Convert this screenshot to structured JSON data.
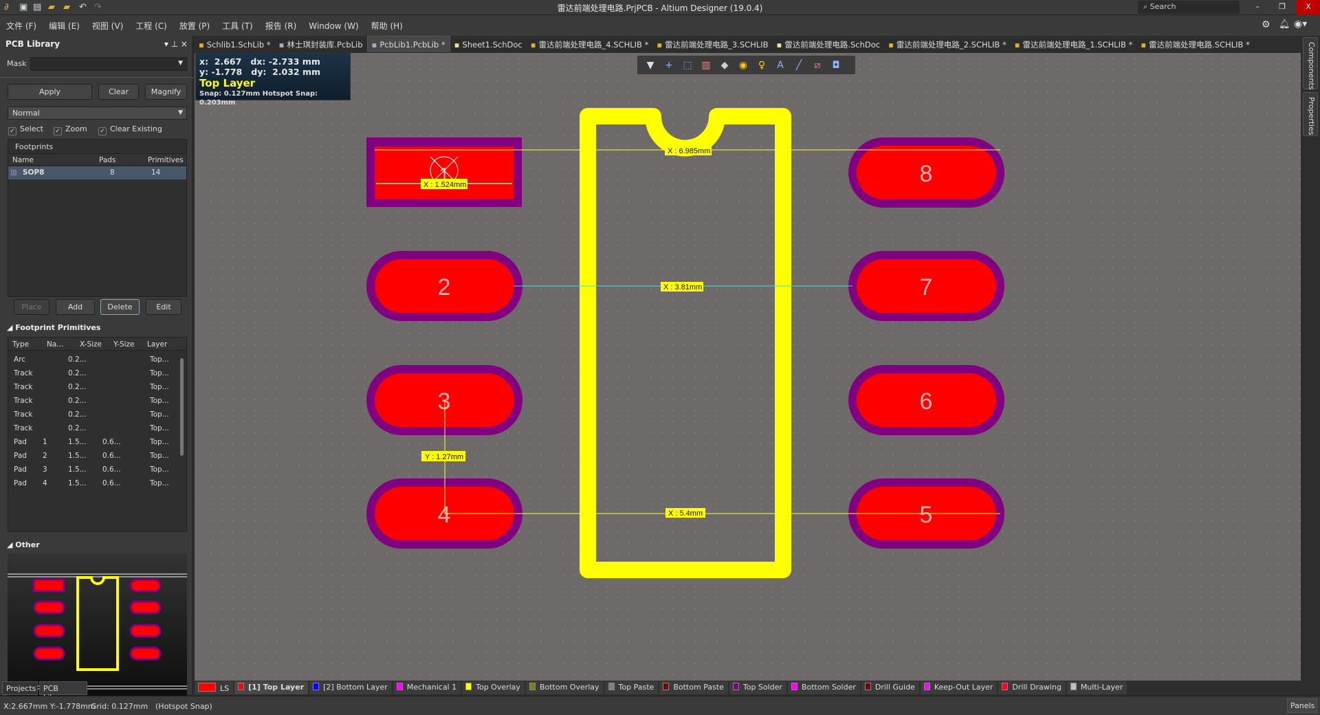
{
  "window": {
    "title": "雷达前端处理电路.PrjPCB - Altium Designer (19.0.4)",
    "search_placeholder": "Search",
    "minimize": "–",
    "restore": "❐",
    "close": "X"
  },
  "menu": [
    "文件 (F)",
    "编辑 (E)",
    "视图 (V)",
    "工程 (C)",
    "放置 (P)",
    "工具 (T)",
    "报告 (R)",
    "Window (W)",
    "帮助 (H)"
  ],
  "doc_tabs": [
    {
      "label": "Schlib1.SchLib *",
      "active": false
    },
    {
      "label": "林士琪封装库.PcbLib",
      "active": false
    },
    {
      "label": "PcbLib1.PcbLib *",
      "active": true
    },
    {
      "label": "Sheet1.SchDoc",
      "active": false
    },
    {
      "label": "雷达前端处理电路_4.SCHLIB *",
      "active": false
    },
    {
      "label": "雷达前端处理电路_3.SCHLIB",
      "active": false
    },
    {
      "label": "雷达前端处理电路.SchDoc",
      "active": false
    },
    {
      "label": "雷达前端处理电路_2.SCHLIB *",
      "active": false
    },
    {
      "label": "雷达前端处理电路_1.SCHLIB *",
      "active": false
    },
    {
      "label": "雷达前端处理电路.SCHLIB *",
      "active": false
    }
  ],
  "panel": {
    "title": "PCB Library",
    "mask_label": "Mask",
    "mask_value": "",
    "apply": "Apply",
    "clear": "Clear",
    "magnify": "Magnify",
    "mode": "Normal",
    "checks": [
      {
        "label": "Select",
        "checked": true
      },
      {
        "label": "Zoom",
        "checked": true
      },
      {
        "label": "Clear Existing",
        "checked": true
      }
    ],
    "footprints_title": "Footprints",
    "fp_columns": [
      "Name",
      "Pads",
      "Primitives"
    ],
    "footprints": [
      {
        "name": "SOP8",
        "pads": "8",
        "primitives": "14"
      }
    ],
    "place": "Place",
    "add": "Add",
    "delete": "Delete",
    "edit": "Edit",
    "primitives_title": "Footprint Primitives",
    "prim_columns": [
      "Type",
      "Na...",
      "X-Size",
      "Y-Size",
      "Layer"
    ],
    "primitives": [
      {
        "type": "Arc",
        "name": "",
        "x": "0.2...",
        "y": "",
        "layer": "Top..."
      },
      {
        "type": "Track",
        "name": "",
        "x": "0.2...",
        "y": "",
        "layer": "Top..."
      },
      {
        "type": "Track",
        "name": "",
        "x": "0.2...",
        "y": "",
        "layer": "Top..."
      },
      {
        "type": "Track",
        "name": "",
        "x": "0.2...",
        "y": "",
        "layer": "Top..."
      },
      {
        "type": "Track",
        "name": "",
        "x": "0.2...",
        "y": "",
        "layer": "Top..."
      },
      {
        "type": "Track",
        "name": "",
        "x": "0.2...",
        "y": "",
        "layer": "Top..."
      },
      {
        "type": "Pad",
        "name": "1",
        "x": "1.5...",
        "y": "0.6...",
        "layer": "Top..."
      },
      {
        "type": "Pad",
        "name": "2",
        "x": "1.5...",
        "y": "0.6...",
        "layer": "Top..."
      },
      {
        "type": "Pad",
        "name": "3",
        "x": "1.5...",
        "y": "0.6...",
        "layer": "Top..."
      },
      {
        "type": "Pad",
        "name": "4",
        "x": "1.5...",
        "y": "0.6...",
        "layer": "Top..."
      }
    ],
    "other_title": "Other",
    "bottom_tabs": [
      "Projects",
      "PCB Library"
    ]
  },
  "coord_box": {
    "x": "x:  2.667   dx: -2.733 mm",
    "y": "y: -1.778   dy:  2.032 mm",
    "layer": "Top Layer",
    "snap": "Snap: 0.127mm Hotspot Snap: 0.203mm"
  },
  "toolbar_icons": [
    "filter-icon",
    "crosshair-icon",
    "select-rect-icon",
    "align-icon",
    "component-icon",
    "pad-icon",
    "via-icon",
    "text-icon",
    "line-icon",
    "route-icon",
    "region-icon"
  ],
  "pads": [
    {
      "label": "1",
      "shape": "rect"
    },
    {
      "label": "2"
    },
    {
      "label": "3"
    },
    {
      "label": "4"
    },
    {
      "label": "5"
    },
    {
      "label": "6"
    },
    {
      "label": "7"
    },
    {
      "label": "8"
    }
  ],
  "dimensions": {
    "d1": "X : 6.985mm",
    "d2": "X : 1.524mm",
    "d3": "X : 3.81mm",
    "d4": "Y : 1.27mm",
    "d5": "X : 5.4mm"
  },
  "colors": {
    "pad": "#ff0000",
    "solder_mask": "#800080",
    "overlay": "#ffff00",
    "canvas": "#6e6a69"
  },
  "right_tabs": [
    "Components",
    "Properties"
  ],
  "layers": [
    {
      "label": "LS",
      "color": "#ff0000"
    },
    {
      "label": "[1] Top Layer",
      "color": "#ff0000",
      "active": true
    },
    {
      "label": "[2] Bottom Layer",
      "color": "#0000ff"
    },
    {
      "label": "Mechanical 1",
      "color": "#ff00ff"
    },
    {
      "label": "Top Overlay",
      "color": "#ffff00"
    },
    {
      "label": "Bottom Overlay",
      "color": "#808000"
    },
    {
      "label": "Top Paste",
      "color": "#808080"
    },
    {
      "label": "Bottom Paste",
      "color": "#800000"
    },
    {
      "label": "Top Solder",
      "color": "#800080"
    },
    {
      "label": "Bottom Solder",
      "color": "#ff00ff"
    },
    {
      "label": "Drill Guide",
      "color": "#800000"
    },
    {
      "label": "Keep-Out Layer",
      "color": "#ff00ff"
    },
    {
      "label": "Drill Drawing",
      "color": "#ff002a"
    },
    {
      "label": "Multi-Layer",
      "color": "#c0c0c0"
    }
  ],
  "status": {
    "coords": "X:2.667mm Y:-1.778mm",
    "grid": "Grid: 0.127mm",
    "snap": "(Hotspot Snap)",
    "panels": "Panels"
  }
}
